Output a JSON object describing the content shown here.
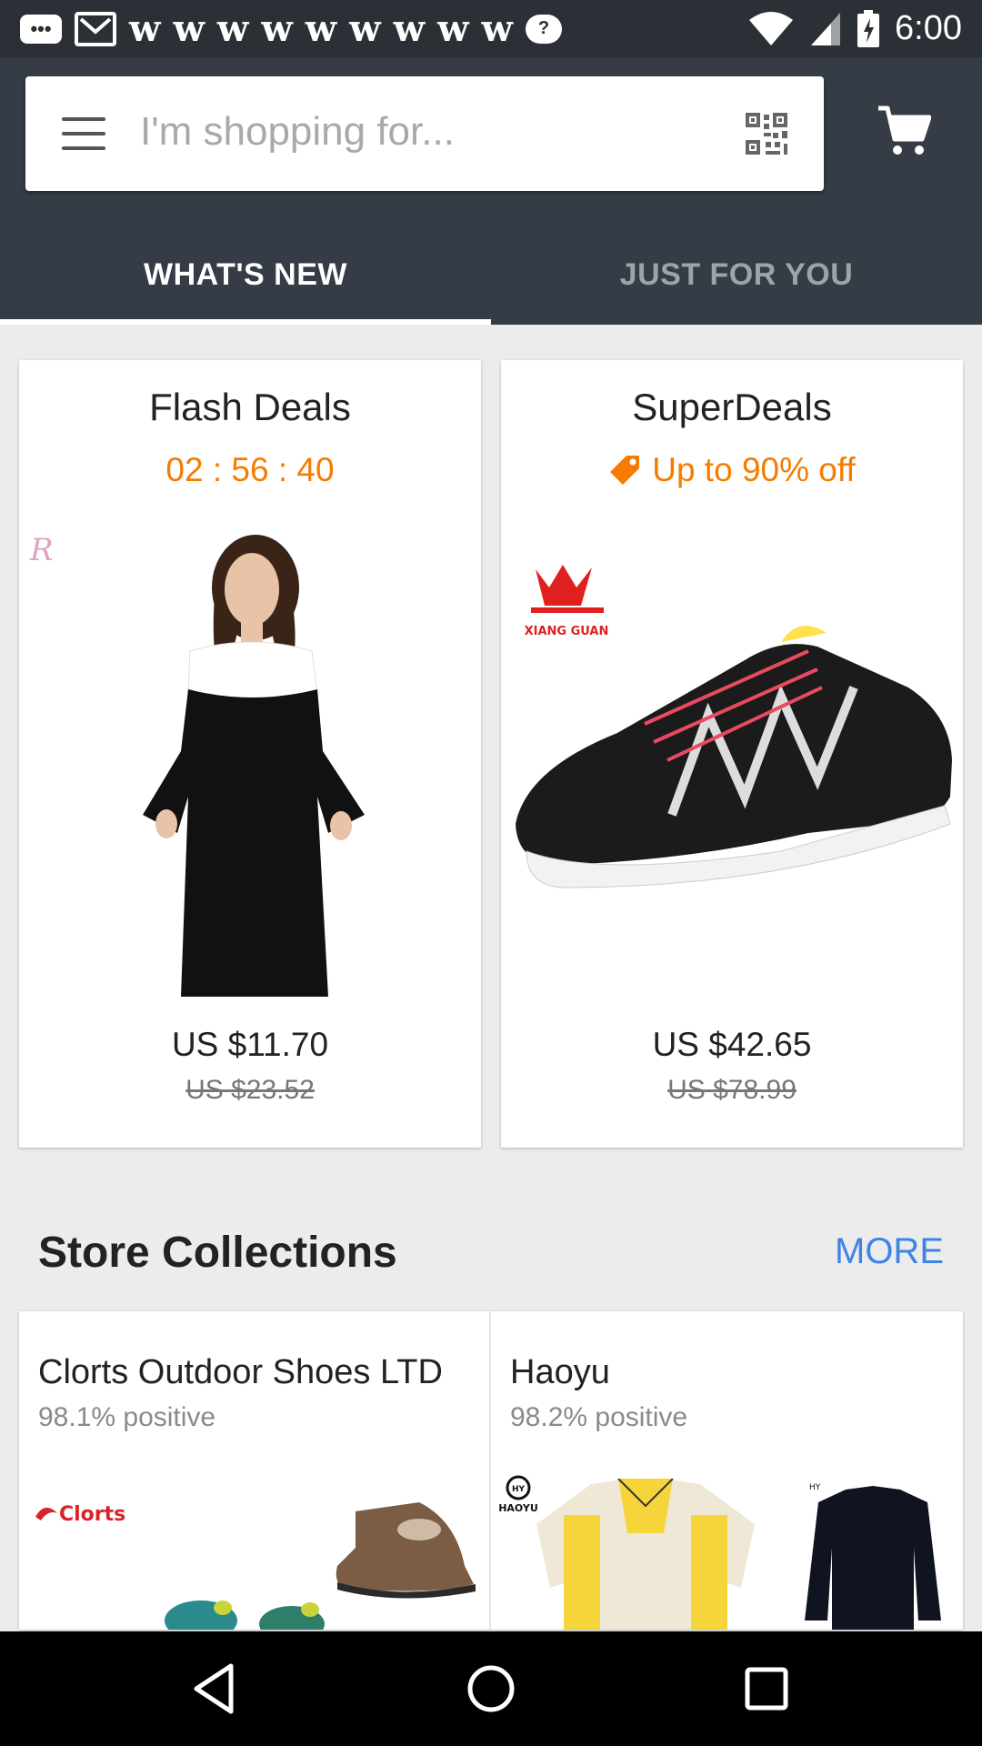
{
  "status_bar": {
    "time": "6:00",
    "notification_icons": [
      "message-icon",
      "gmail-icon",
      "w-icon",
      "w-icon",
      "w-icon",
      "w-icon",
      "w-icon",
      "w-icon",
      "w-icon",
      "w-icon",
      "w-icon",
      "chat-icon"
    ],
    "notif_glyph_w": "w"
  },
  "header": {
    "search_placeholder": "I'm shopping for...",
    "tabs": [
      {
        "label": "WHAT'S NEW",
        "active": true
      },
      {
        "label": "JUST FOR YOU",
        "active": false
      }
    ]
  },
  "deals": [
    {
      "title": "Flash Deals",
      "subtitle": "02 : 56 : 40",
      "price": "US $11.70",
      "old_price": "US $23.52",
      "image": "black-white-dress-image"
    },
    {
      "title": "SuperDeals",
      "subtitle": "Up to 90% off",
      "price": "US $42.65",
      "old_price": "US $78.99",
      "image": "black-sneaker-image",
      "brand_logo_text": "XIANG GUAN"
    }
  ],
  "store_collections": {
    "title": "Store Collections",
    "more_label": "MORE",
    "stores": [
      {
        "name": "Clorts Outdoor Shoes LTD",
        "rating": "98.1% positive",
        "logo_text": "Clorts"
      },
      {
        "name": "Haoyu",
        "rating": "98.2% positive",
        "logo_text": "HAOYU"
      }
    ]
  },
  "colors": {
    "header_bg": "#353c46",
    "accent_orange": "#f57c00",
    "link_blue": "#3d84e6"
  }
}
